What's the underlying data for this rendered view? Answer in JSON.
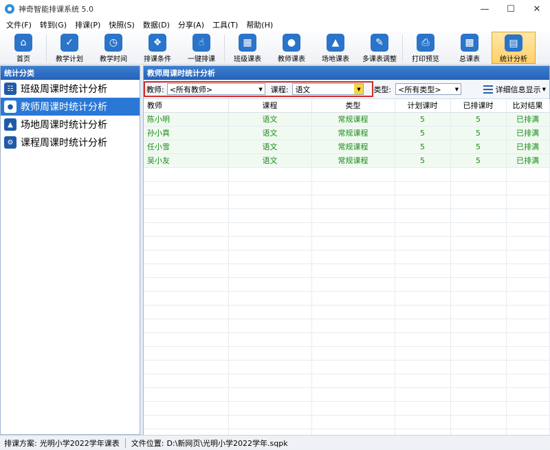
{
  "window": {
    "title": "神奇智能排课系统 5.0"
  },
  "menu": [
    "文件(F)",
    "转到(G)",
    "排课(P)",
    "快照(S)",
    "数据(D)",
    "分享(A)",
    "工具(T)",
    "帮助(H)"
  ],
  "toolbar": [
    {
      "label": "首页",
      "icon": "home-icon"
    },
    {
      "label": "教学计划",
      "icon": "clipboard-icon"
    },
    {
      "label": "教学时间",
      "icon": "clock-icon"
    },
    {
      "label": "排课条件",
      "icon": "conditions-icon"
    },
    {
      "label": "一键排课",
      "icon": "click-hand-icon"
    },
    {
      "label": "班级课表",
      "icon": "calendar-icon"
    },
    {
      "label": "教师课表",
      "icon": "teacher-icon"
    },
    {
      "label": "场地课表",
      "icon": "building-icon"
    },
    {
      "label": "多课表调整",
      "icon": "adjust-icon"
    },
    {
      "label": "打印预览",
      "icon": "printer-icon"
    },
    {
      "label": "总课表",
      "icon": "calendar-total-icon"
    },
    {
      "label": "统计分析",
      "icon": "chart-icon"
    }
  ],
  "left_panel": {
    "title": "统计分类",
    "items": [
      {
        "label": "班级周课时统计分析"
      },
      {
        "label": "教师周课时统计分析"
      },
      {
        "label": "场地周课时统计分析"
      },
      {
        "label": "课程周课时统计分析"
      }
    ],
    "selected_index": 1
  },
  "right_panel": {
    "title": "教师周课时统计分析",
    "filters": {
      "teacher_label": "教师:",
      "teacher_value": "<所有教师>",
      "course_label": "课程:",
      "course_value": "语文",
      "type_label": "类型:",
      "type_value": "<所有类型>"
    },
    "detail_button": "详细信息显示"
  },
  "table": {
    "columns": [
      "教师",
      "课程",
      "类型",
      "计划课时",
      "已排课时",
      "比对结果"
    ],
    "rows": [
      [
        "陈小明",
        "语文",
        "常规课程",
        "5",
        "5",
        "已排满"
      ],
      [
        "孙小真",
        "语文",
        "常规课程",
        "5",
        "5",
        "已排满"
      ],
      [
        "任小雪",
        "语文",
        "常规课程",
        "5",
        "5",
        "已排满"
      ],
      [
        "吴小友",
        "语文",
        "常规课程",
        "5",
        "5",
        "已排满"
      ]
    ]
  },
  "status": {
    "scheme_label": "排课方案:",
    "scheme_value": "光明小学2022学年课表",
    "file_label": "文件位置:",
    "file_value": "D:\\新网页\\光明小学2022学年.sqpk"
  },
  "colors": {
    "accent": "#2a78d6",
    "data_text": "#1d8a1d",
    "highlight_box": "#d42a2a"
  }
}
